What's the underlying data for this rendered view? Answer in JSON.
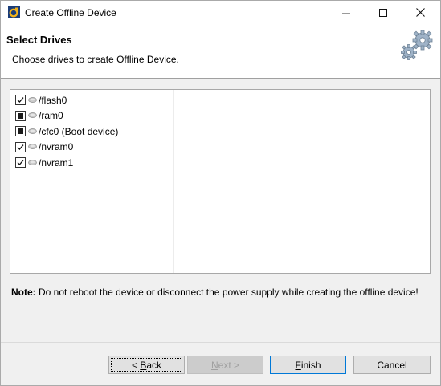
{
  "window": {
    "title": "Create Offline Device",
    "icon": "app-logo-icon",
    "controls": {
      "minimize": "minimize-icon",
      "maximize": "maximize-icon",
      "close": "close-icon"
    }
  },
  "header": {
    "title": "Select Drives",
    "description": "Choose drives to create Offline Device.",
    "icon": "gears-icon"
  },
  "drives": [
    {
      "label": "/flash0",
      "state": "checked"
    },
    {
      "label": "/ram0",
      "state": "partial"
    },
    {
      "label": "/cfc0 (Boot device)",
      "state": "partial"
    },
    {
      "label": "/nvram0",
      "state": "checked"
    },
    {
      "label": "/nvram1",
      "state": "checked"
    }
  ],
  "note": {
    "prefix": "Note:",
    "text": " Do not reboot the device or disconnect the power supply while creating the offline device!"
  },
  "buttons": {
    "back": {
      "prefix": "< ",
      "mnemonic": "B",
      "rest": "ack",
      "enabled": true
    },
    "next": {
      "mnemonic": "N",
      "rest": "ext >",
      "enabled": false
    },
    "finish": {
      "mnemonic": "F",
      "rest": "inish",
      "enabled": true
    },
    "cancel": {
      "label": "Cancel",
      "enabled": true
    }
  },
  "colors": {
    "accent_border": "#0078d7",
    "window_bg": "#f0f0f0",
    "header_bg": "#ffffff"
  }
}
